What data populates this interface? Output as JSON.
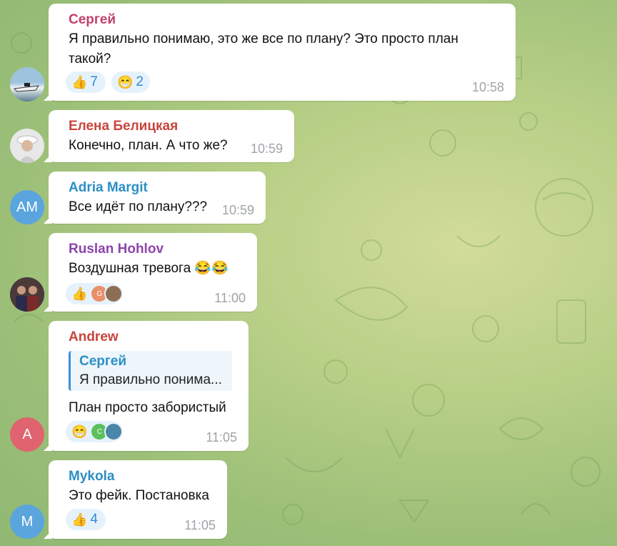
{
  "messages": [
    {
      "author": "Сергей",
      "author_color": "#c0406e",
      "lines": [
        "Я правильно понимаю, это же все по плану? Это просто план",
        "такой?"
      ],
      "time": "10:58",
      "reactions": [
        {
          "emoji_icon": "thumbs-up-icon",
          "emoji": "👍",
          "count": "7"
        },
        {
          "emoji_icon": "grinning-face-icon",
          "emoji": "😁",
          "count": "2"
        }
      ],
      "avatar": {
        "type": "photo",
        "icon": "boat-photo-avatar"
      }
    },
    {
      "author": "Елена Белицкая",
      "author_color": "#c8453c",
      "lines": [
        "Конечно, план. А что же?"
      ],
      "time": "10:59",
      "avatar": {
        "type": "photo",
        "icon": "woman-photo-avatar"
      }
    },
    {
      "author": "Adria Margit",
      "author_color": "#2b8fc6",
      "lines": [
        "Все идёт по плану???"
      ],
      "time": "10:59",
      "avatar": {
        "type": "initials",
        "initials": "AM",
        "color": "#5aa5dd"
      }
    },
    {
      "author": "Ruslan Hohlov",
      "author_color": "#8e44ad",
      "lines": [
        "Воздушная тревога 😂😂"
      ],
      "time": "11:00",
      "reactions": [
        {
          "emoji_icon": "thumbs-up-icon",
          "emoji": "👍",
          "reactors": [
            {
              "initial": "G",
              "color": "#e8906a"
            },
            {
              "initial": "",
              "color": "#8c6e54"
            }
          ]
        }
      ],
      "avatar": {
        "type": "photo",
        "icon": "people-photo-avatar"
      }
    },
    {
      "author": "Andrew",
      "author_color": "#c8453c",
      "reply": {
        "author": "Сергей",
        "text": "Я правильно понима..."
      },
      "lines": [
        "План просто забористый"
      ],
      "time": "11:05",
      "reactions": [
        {
          "emoji_icon": "grinning-face-icon",
          "emoji": "😁",
          "reactors": [
            {
              "initial": "C",
              "color": "#5cc05c"
            },
            {
              "initial": "",
              "color": "#4a86a8"
            }
          ]
        }
      ],
      "avatar": {
        "type": "initials",
        "initials": "A",
        "color": "#e06370"
      }
    },
    {
      "author": "Mykola",
      "author_color": "#2b8fc6",
      "lines": [
        "Это фейк. Постановка"
      ],
      "time": "11:05",
      "reactions": [
        {
          "emoji_icon": "thumbs-up-icon",
          "emoji": "👍",
          "count": "4"
        }
      ],
      "avatar": {
        "type": "initials",
        "initials": "M",
        "color": "#5aa5dd"
      }
    }
  ]
}
